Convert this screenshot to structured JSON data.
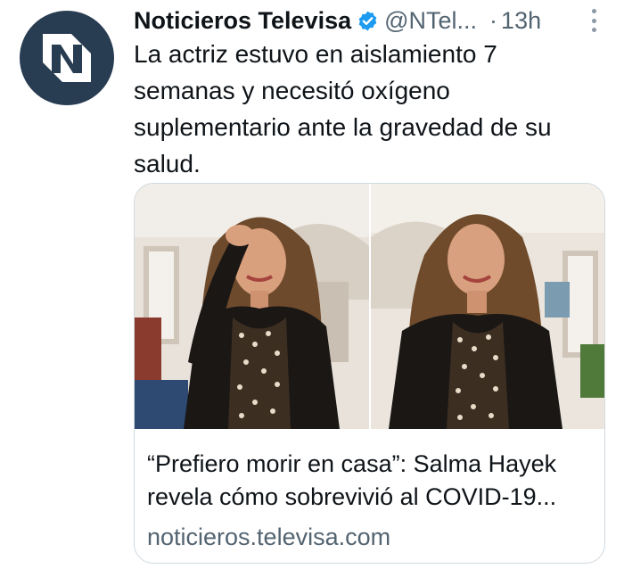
{
  "tweet": {
    "author_name": "Noticieros Televisa",
    "handle": "@NTel...",
    "separator": "·",
    "time": "13h",
    "text": "La actriz estuvo en aislamiento 7\nsemanas y necesitó oxígeno\nsuplementario ante la gravedad de su\nsalud.",
    "verified": true,
    "avatar_icon": "noticieros-logo-icon",
    "more_icon": "more-vertical-icon"
  },
  "card": {
    "title": "“Prefiero morir en casa”: Salma Hayek revela cómo sobrevivió al COVID-19...",
    "domain": "noticieros.televisa.com"
  },
  "colors": {
    "avatar_bg": "#283c52",
    "verified": "#1d9bf0",
    "muted_text": "#536471",
    "border": "#cfd9de"
  }
}
